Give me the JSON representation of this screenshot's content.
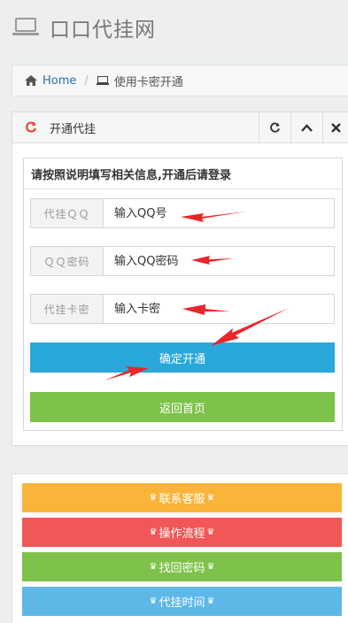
{
  "header": {
    "site_title": "口口代挂网",
    "laptop_icon": "laptop-icon"
  },
  "breadcrumb": {
    "home_label": "Home",
    "separator": "/",
    "current_label": "使用卡密开通"
  },
  "widget": {
    "title": "开通代挂",
    "tools": {
      "refresh": "refresh-icon",
      "collapse": "chevron-up-icon",
      "close": "close-icon"
    },
    "panel_heading": "请按照说明填写相关信息,开通后请登录",
    "fields": [
      {
        "addon": "代挂ＱＱ",
        "placeholder": "输入QQ号"
      },
      {
        "addon": "ＱＱ密码",
        "placeholder": "输入QQ密码"
      },
      {
        "addon": "代挂卡密",
        "placeholder": "输入卡密"
      }
    ],
    "submit_label": "确定开通",
    "back_label": "返回首页"
  },
  "links": [
    {
      "label": "联系客服",
      "color": "#f8b53a"
    },
    {
      "label": "操作流程",
      "color": "#f25757"
    },
    {
      "label": "找回密码",
      "color": "#7dc24a"
    },
    {
      "label": "代挂时间",
      "color": "#5db8e8"
    }
  ],
  "colors": {
    "submit": "#2aa8db",
    "back": "#7dc24a",
    "arrow": "#e8262b",
    "link": "#2a6fa8"
  }
}
